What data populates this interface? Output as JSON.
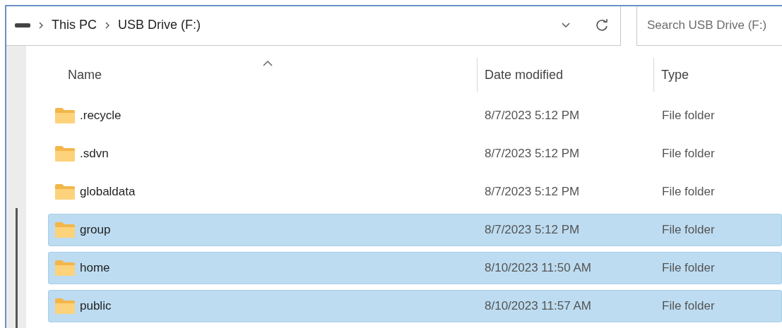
{
  "address_bar": {
    "breadcrumbs": [
      "This PC",
      "USB Drive (F:)"
    ]
  },
  "search": {
    "placeholder": "Search USB Drive (F:)"
  },
  "columns": [
    {
      "label": "Name",
      "sorted": true
    },
    {
      "label": "Date modified",
      "sorted": false
    },
    {
      "label": "Type",
      "sorted": false
    }
  ],
  "rows": [
    {
      "name": ".recycle",
      "date": "8/7/2023 5:12 PM",
      "type": "File folder",
      "selected": false
    },
    {
      "name": ".sdvn",
      "date": "8/7/2023 5:12 PM",
      "type": "File folder",
      "selected": false
    },
    {
      "name": "globaldata",
      "date": "8/7/2023 5:12 PM",
      "type": "File folder",
      "selected": false
    },
    {
      "name": "group",
      "date": "8/7/2023 5:12 PM",
      "type": "File folder",
      "selected": true
    },
    {
      "name": "home",
      "date": "8/10/2023 11:50 AM",
      "type": "File folder",
      "selected": true
    },
    {
      "name": "public",
      "date": "8/10/2023 11:57 AM",
      "type": "File folder",
      "selected": true
    }
  ]
}
